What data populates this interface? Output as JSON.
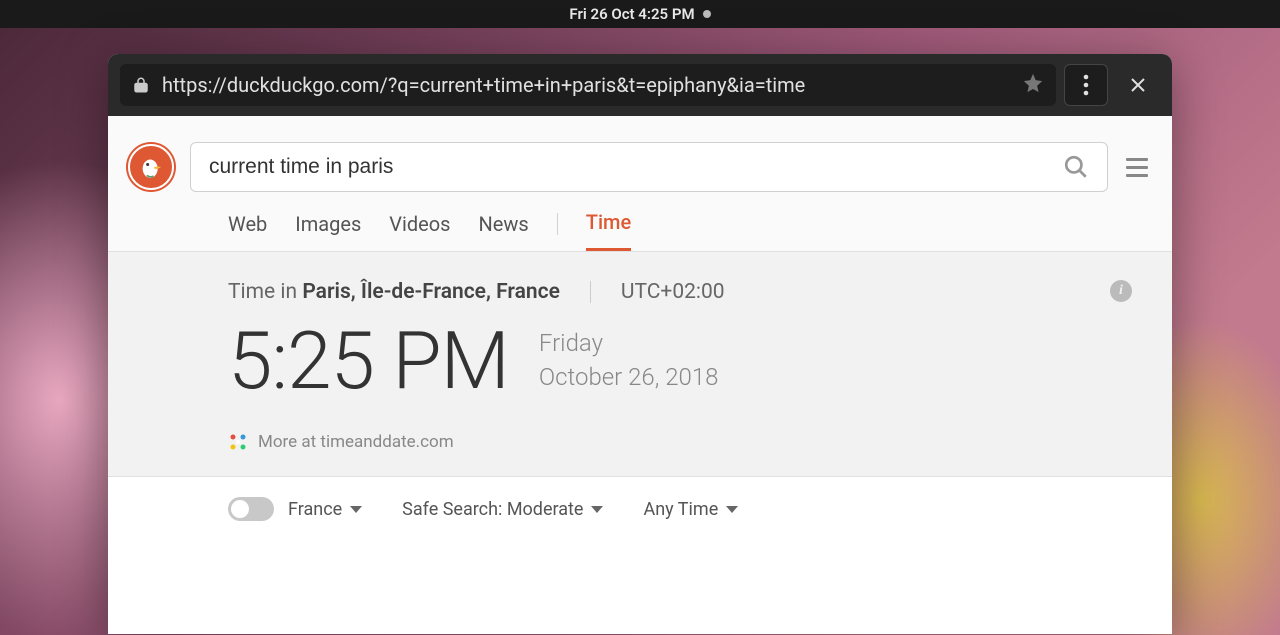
{
  "system": {
    "clock": "Fri 26 Oct   4:25 PM"
  },
  "browser": {
    "url": "https://duckduckgo.com/?q=current+time+in+paris&t=epiphany&ia=time"
  },
  "search": {
    "query": "current time in paris"
  },
  "tabs": {
    "web": "Web",
    "images": "Images",
    "videos": "Videos",
    "news": "News",
    "time": "Time"
  },
  "answer": {
    "prefix": "Time in ",
    "location": "Paris, Île-de-France, France",
    "offset": "UTC+02:00",
    "time": "5:25 PM",
    "day": "Friday",
    "date": "October 26, 2018",
    "more": "More at timeanddate.com"
  },
  "filters": {
    "region": "France",
    "safesearch": "Safe Search: Moderate",
    "timefilter": "Any Time"
  }
}
